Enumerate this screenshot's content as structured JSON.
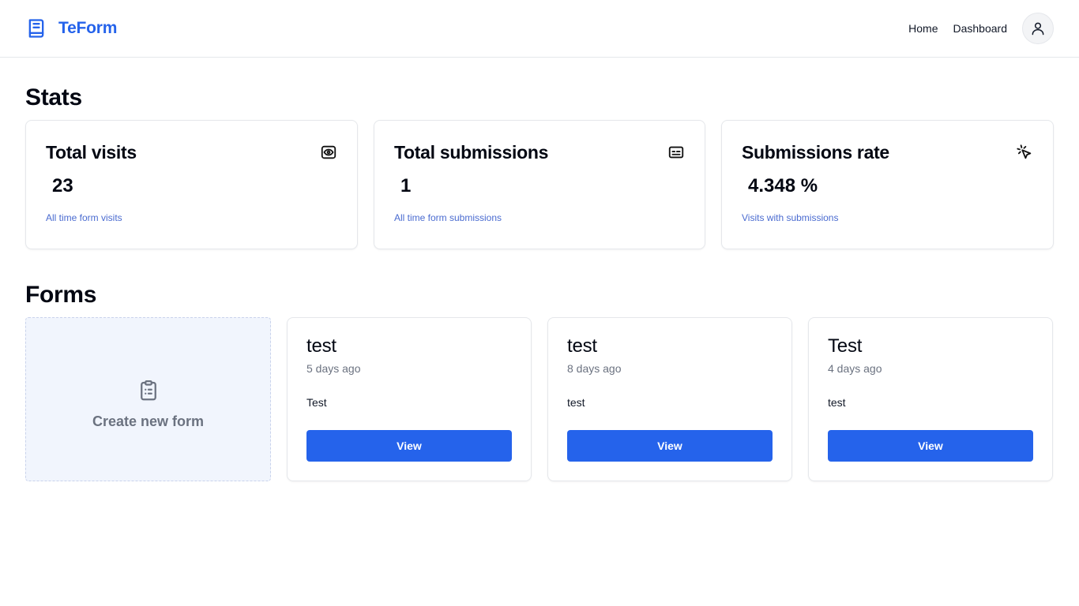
{
  "brand": {
    "name": "TeForm",
    "icon": "book-icon",
    "color": "#2563eb"
  },
  "nav": {
    "home": "Home",
    "dashboard": "Dashboard",
    "avatar_icon": "user-icon"
  },
  "stats": {
    "title": "Stats",
    "cards": [
      {
        "label": "Total visits",
        "value": "23",
        "caption": "All time form visits",
        "icon": "eye-icon"
      },
      {
        "label": "Total submissions",
        "value": "1",
        "caption": "All time form submissions",
        "icon": "id-card-icon"
      },
      {
        "label": "Submissions rate",
        "value": "4.348 %",
        "caption": "Visits with submissions",
        "icon": "cursor-click-icon"
      }
    ]
  },
  "forms": {
    "title": "Forms",
    "create_label": "Create new form",
    "create_icon": "clipboard-icon",
    "items": [
      {
        "name": "test",
        "time": "5 days ago",
        "description": "Test",
        "button": "View"
      },
      {
        "name": "test",
        "time": "8 days ago",
        "description": "test",
        "button": "View"
      },
      {
        "name": "Test",
        "time": "4 days ago",
        "description": "test",
        "button": "View"
      }
    ]
  }
}
